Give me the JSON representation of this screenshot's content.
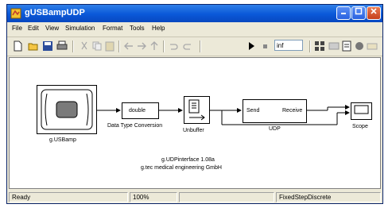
{
  "window": {
    "title": "gUSBampUDP"
  },
  "menu": [
    "File",
    "Edit",
    "View",
    "Simulation",
    "Format",
    "Tools",
    "Help"
  ],
  "toolbar": {
    "stop_time": "inf"
  },
  "model": {
    "blocks": {
      "usbamp": "g.USBamp",
      "dtc_text": "double",
      "dtc": "Data Type Conversion",
      "unbuffer": "Unbuffer",
      "udp_send": "Send",
      "udp_receive": "Receive",
      "udp": "UDP",
      "scope": "Scope"
    },
    "annotation": {
      "line1": "g.UDPinterface 1.08a",
      "line2": "g.tec medical engineering GmbH"
    }
  },
  "status": {
    "ready": "Ready",
    "zoom": "100%",
    "solver": "FixedStepDiscrete"
  }
}
